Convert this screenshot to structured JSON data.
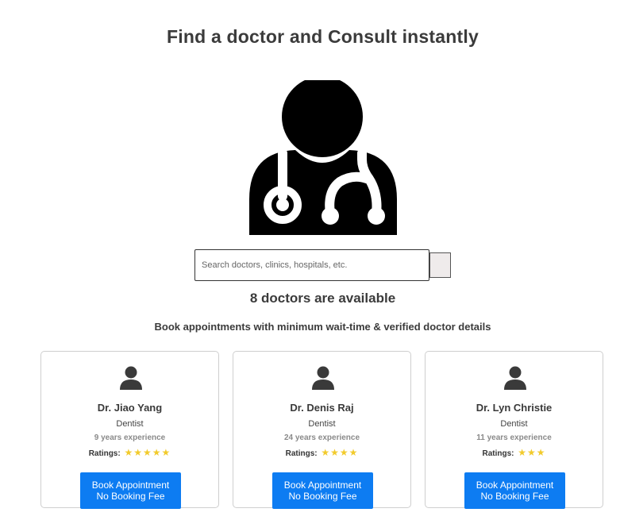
{
  "header": {
    "title": "Find a doctor and Consult instantly"
  },
  "hero": {
    "icon": "doctor-stethoscope-icon"
  },
  "search": {
    "placeholder": "Search doctors, clinics, hospitals, etc.",
    "value": ""
  },
  "summary": {
    "count_text": "8 doctors are available",
    "subtitle": "Book appointments with minimum wait-time & verified doctor details"
  },
  "doctors": [
    {
      "name": "Dr. Jiao Yang",
      "specialty": "Dentist",
      "experience": "9 years experience",
      "ratings_label": "Ratings:",
      "stars": 5,
      "stars_text": "★★★★★",
      "button_line1": "Book Appointment",
      "button_line2": "No Booking Fee"
    },
    {
      "name": "Dr. Denis Raj",
      "specialty": "Dentist",
      "experience": "24 years experience",
      "ratings_label": "Ratings:",
      "stars": 4,
      "stars_text": "★★★★",
      "button_line1": "Book Appointment",
      "button_line2": "No Booking Fee"
    },
    {
      "name": "Dr. Lyn Christie",
      "specialty": "Dentist",
      "experience": "11 years experience",
      "ratings_label": "Ratings:",
      "stars": 3,
      "stars_text": "★★★",
      "button_line1": "Book Appointment",
      "button_line2": "No Booking Fee"
    }
  ],
  "colors": {
    "accent": "#0d7cf2",
    "star": "#f2cb2c",
    "text": "#3b3b3b"
  }
}
